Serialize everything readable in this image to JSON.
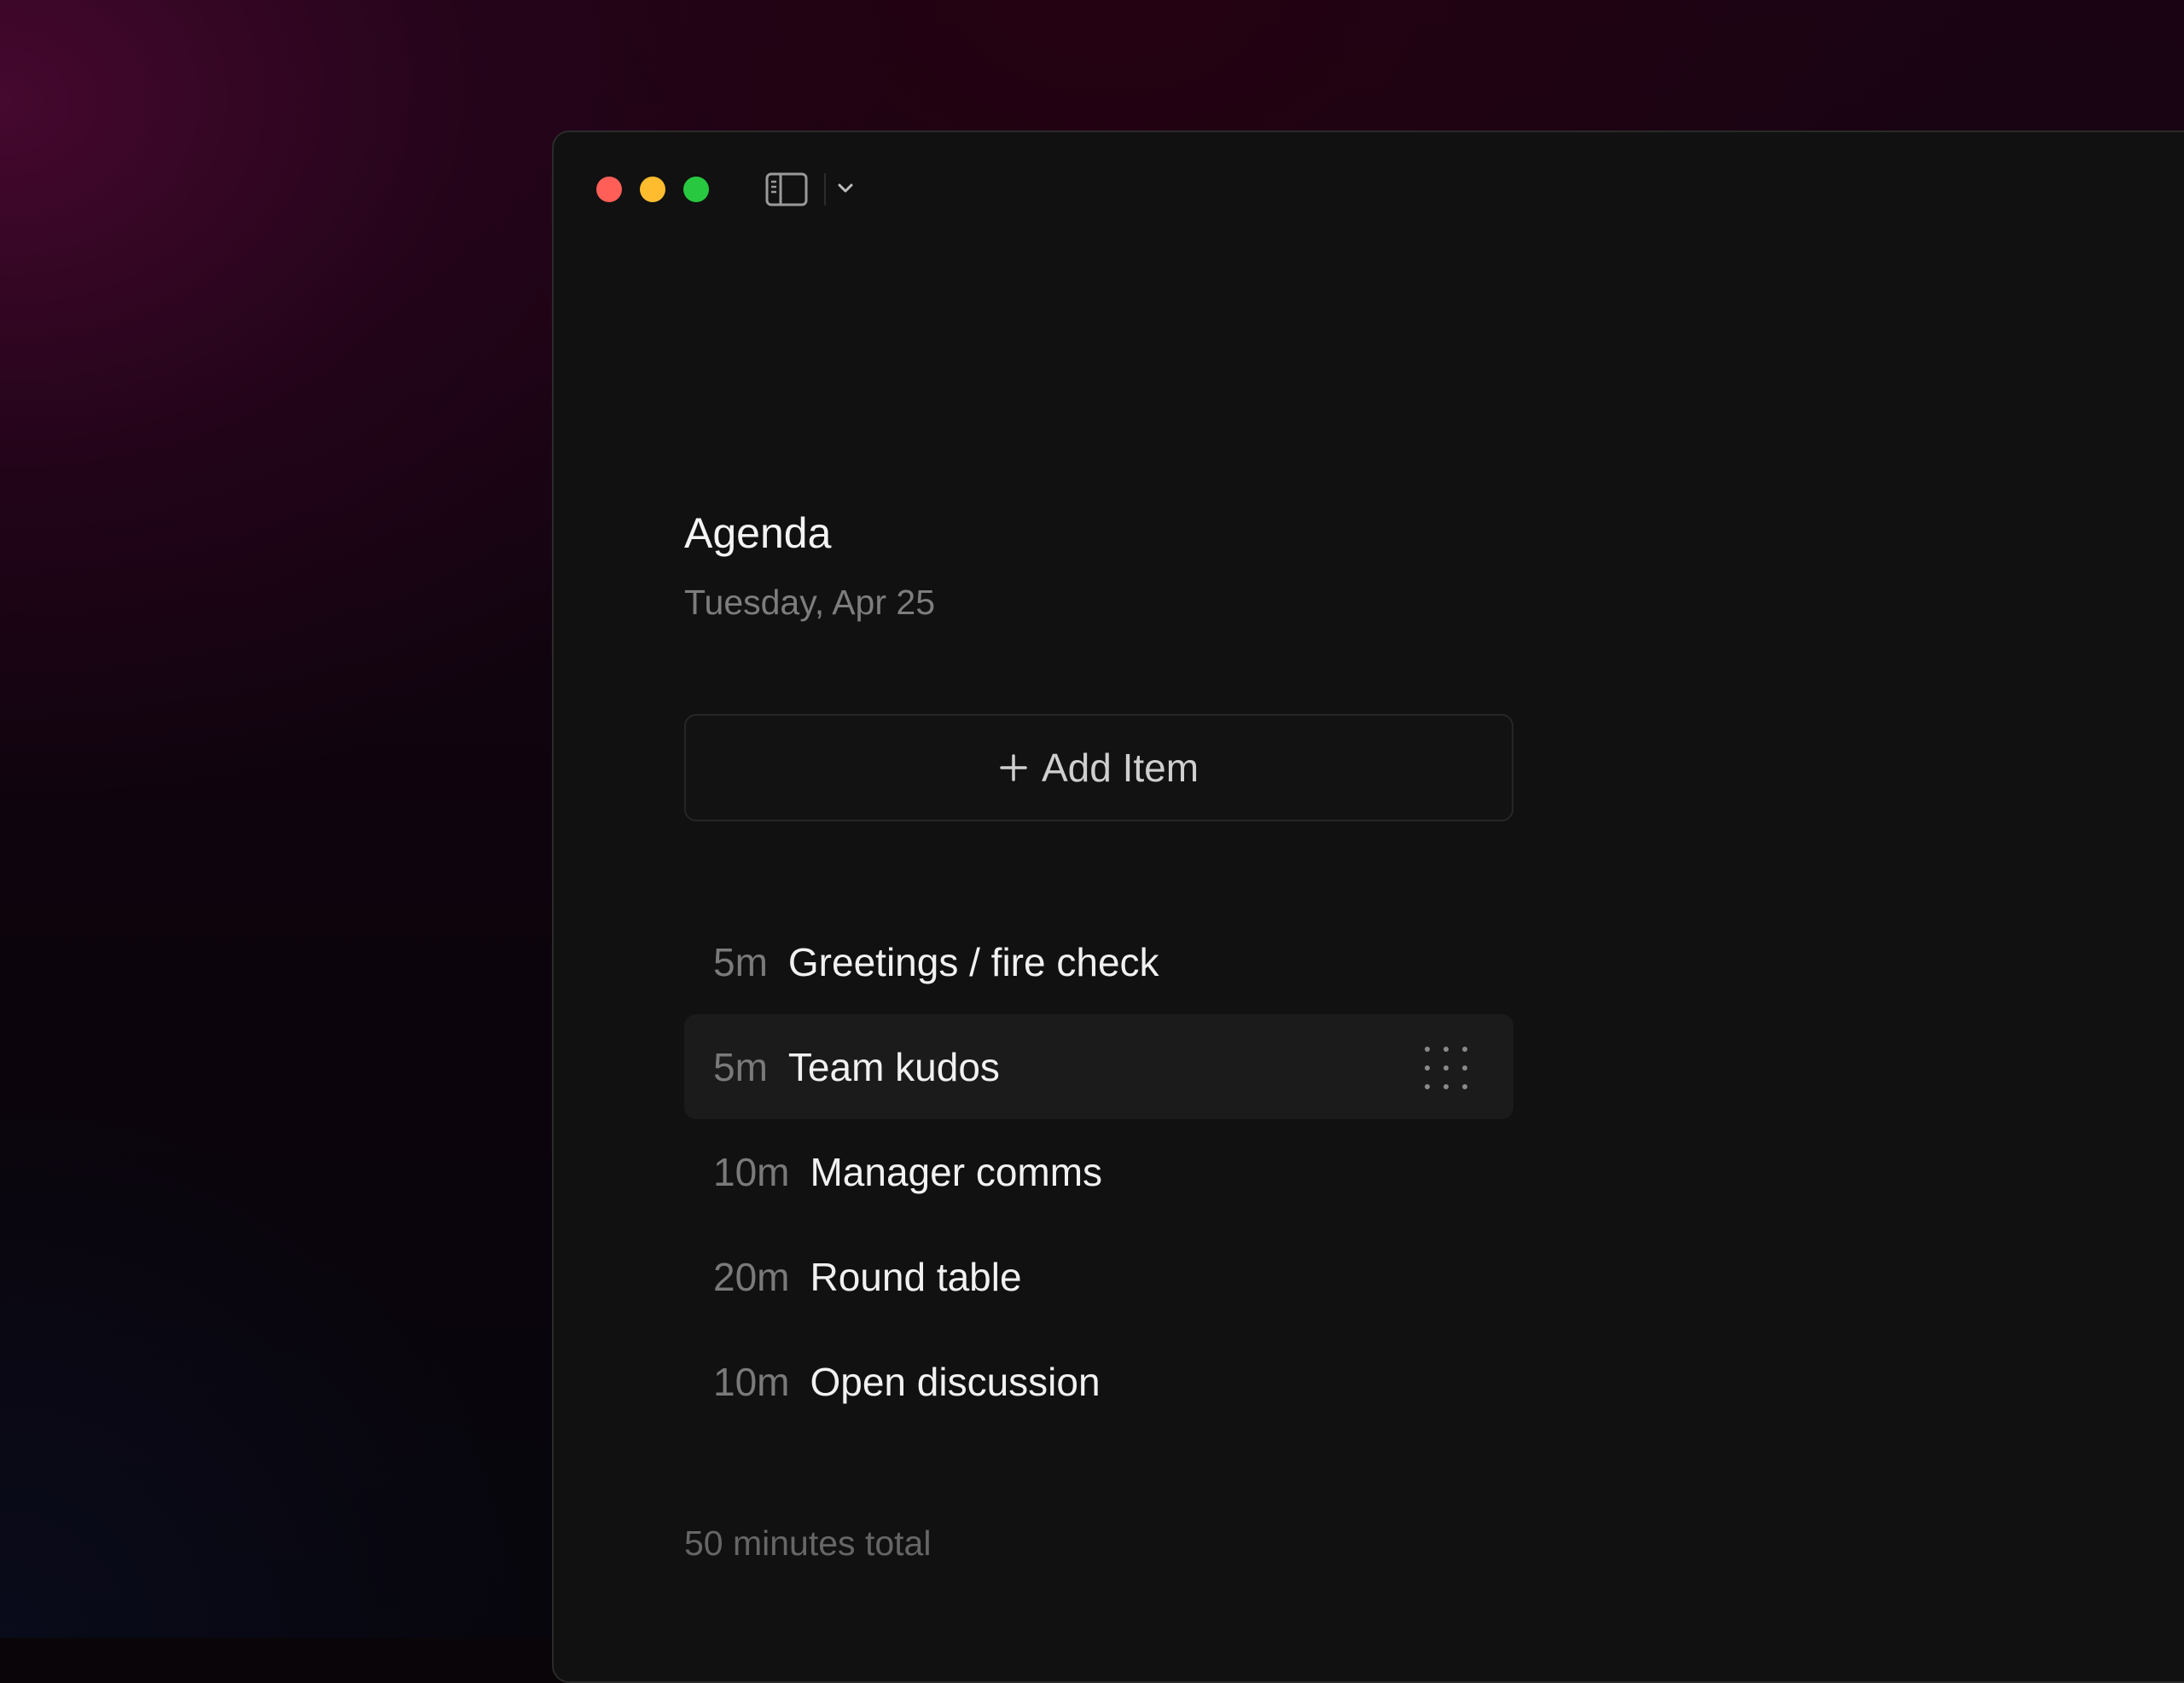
{
  "window": {
    "sidebar_toggle_icon": "sidebar-icon",
    "chevron_icon": "chevron-down-icon",
    "traffic_colors": {
      "close": "#ff5f57",
      "minimize": "#febc2e",
      "zoom": "#28c840"
    }
  },
  "agenda": {
    "title": "Agenda",
    "date": "Tuesday, Apr 25",
    "add_item_icon": "plus-icon",
    "add_item_label": "Add Item",
    "items": [
      {
        "duration": "5m",
        "title": "Greetings / fire check"
      },
      {
        "duration": "5m",
        "title": "Team kudos",
        "active": true
      },
      {
        "duration": "10m",
        "title": "Manager comms"
      },
      {
        "duration": "20m",
        "title": "Round table"
      },
      {
        "duration": "10m",
        "title": "Open discussion"
      }
    ],
    "drag_handle_icon": "drag-handle-icon",
    "total": "50 minutes total"
  }
}
